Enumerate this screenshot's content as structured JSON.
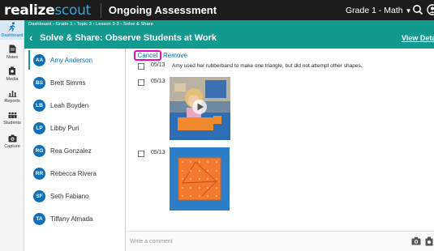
{
  "topbar": {
    "logo_realize": "realize",
    "logo_scout": "scout",
    "app_title": "Ongoing Assessment",
    "grade_selector": "Grade 1 - Math"
  },
  "rail": {
    "items": [
      {
        "label": "Dashboard",
        "icon": "run-icon"
      },
      {
        "label": "Notes",
        "icon": "notes-icon"
      },
      {
        "label": "Media",
        "icon": "media-icon"
      },
      {
        "label": "Reports",
        "icon": "bar-chart-icon"
      },
      {
        "label": "Students",
        "icon": "people-icon"
      },
      {
        "label": "Capture",
        "icon": "camera-icon"
      }
    ]
  },
  "breadcrumb": "Dashboard › Grade 1 › Topic 3 › Lesson 3-3 › Solve & Share",
  "header": {
    "title": "Solve & Share: Observe Students at Work",
    "view_details": "View Details"
  },
  "students": [
    {
      "initials": "AA",
      "name": "Amy Anderson"
    },
    {
      "initials": "BS",
      "name": "Brett Simms"
    },
    {
      "initials": "LB",
      "name": "Leah Boyden"
    },
    {
      "initials": "LP",
      "name": "Libby Puri"
    },
    {
      "initials": "RG",
      "name": "Rea Gonzalez"
    },
    {
      "initials": "RR",
      "name": "Rebecca Rivera"
    },
    {
      "initials": "SF",
      "name": "Seth Fabiano"
    },
    {
      "initials": "TA",
      "name": "Tiffany Almada"
    }
  ],
  "main": {
    "cancel_label": "Cancel",
    "remove_label": "Remove",
    "entries": [
      {
        "date": "05/13",
        "note": "Amy used her rubberband to make one triangle, but did not attempt other shapes."
      },
      {
        "date": "05/13",
        "note": ""
      },
      {
        "date": "05/13",
        "note": ""
      }
    ]
  },
  "comment": {
    "placeholder": "Write a comment"
  },
  "colors": {
    "topbar": "#1c1c1c",
    "teal": "#139a8e",
    "avatar": "#136fb3",
    "highlight": "#e20fbf",
    "link": "#0b6fb0"
  }
}
